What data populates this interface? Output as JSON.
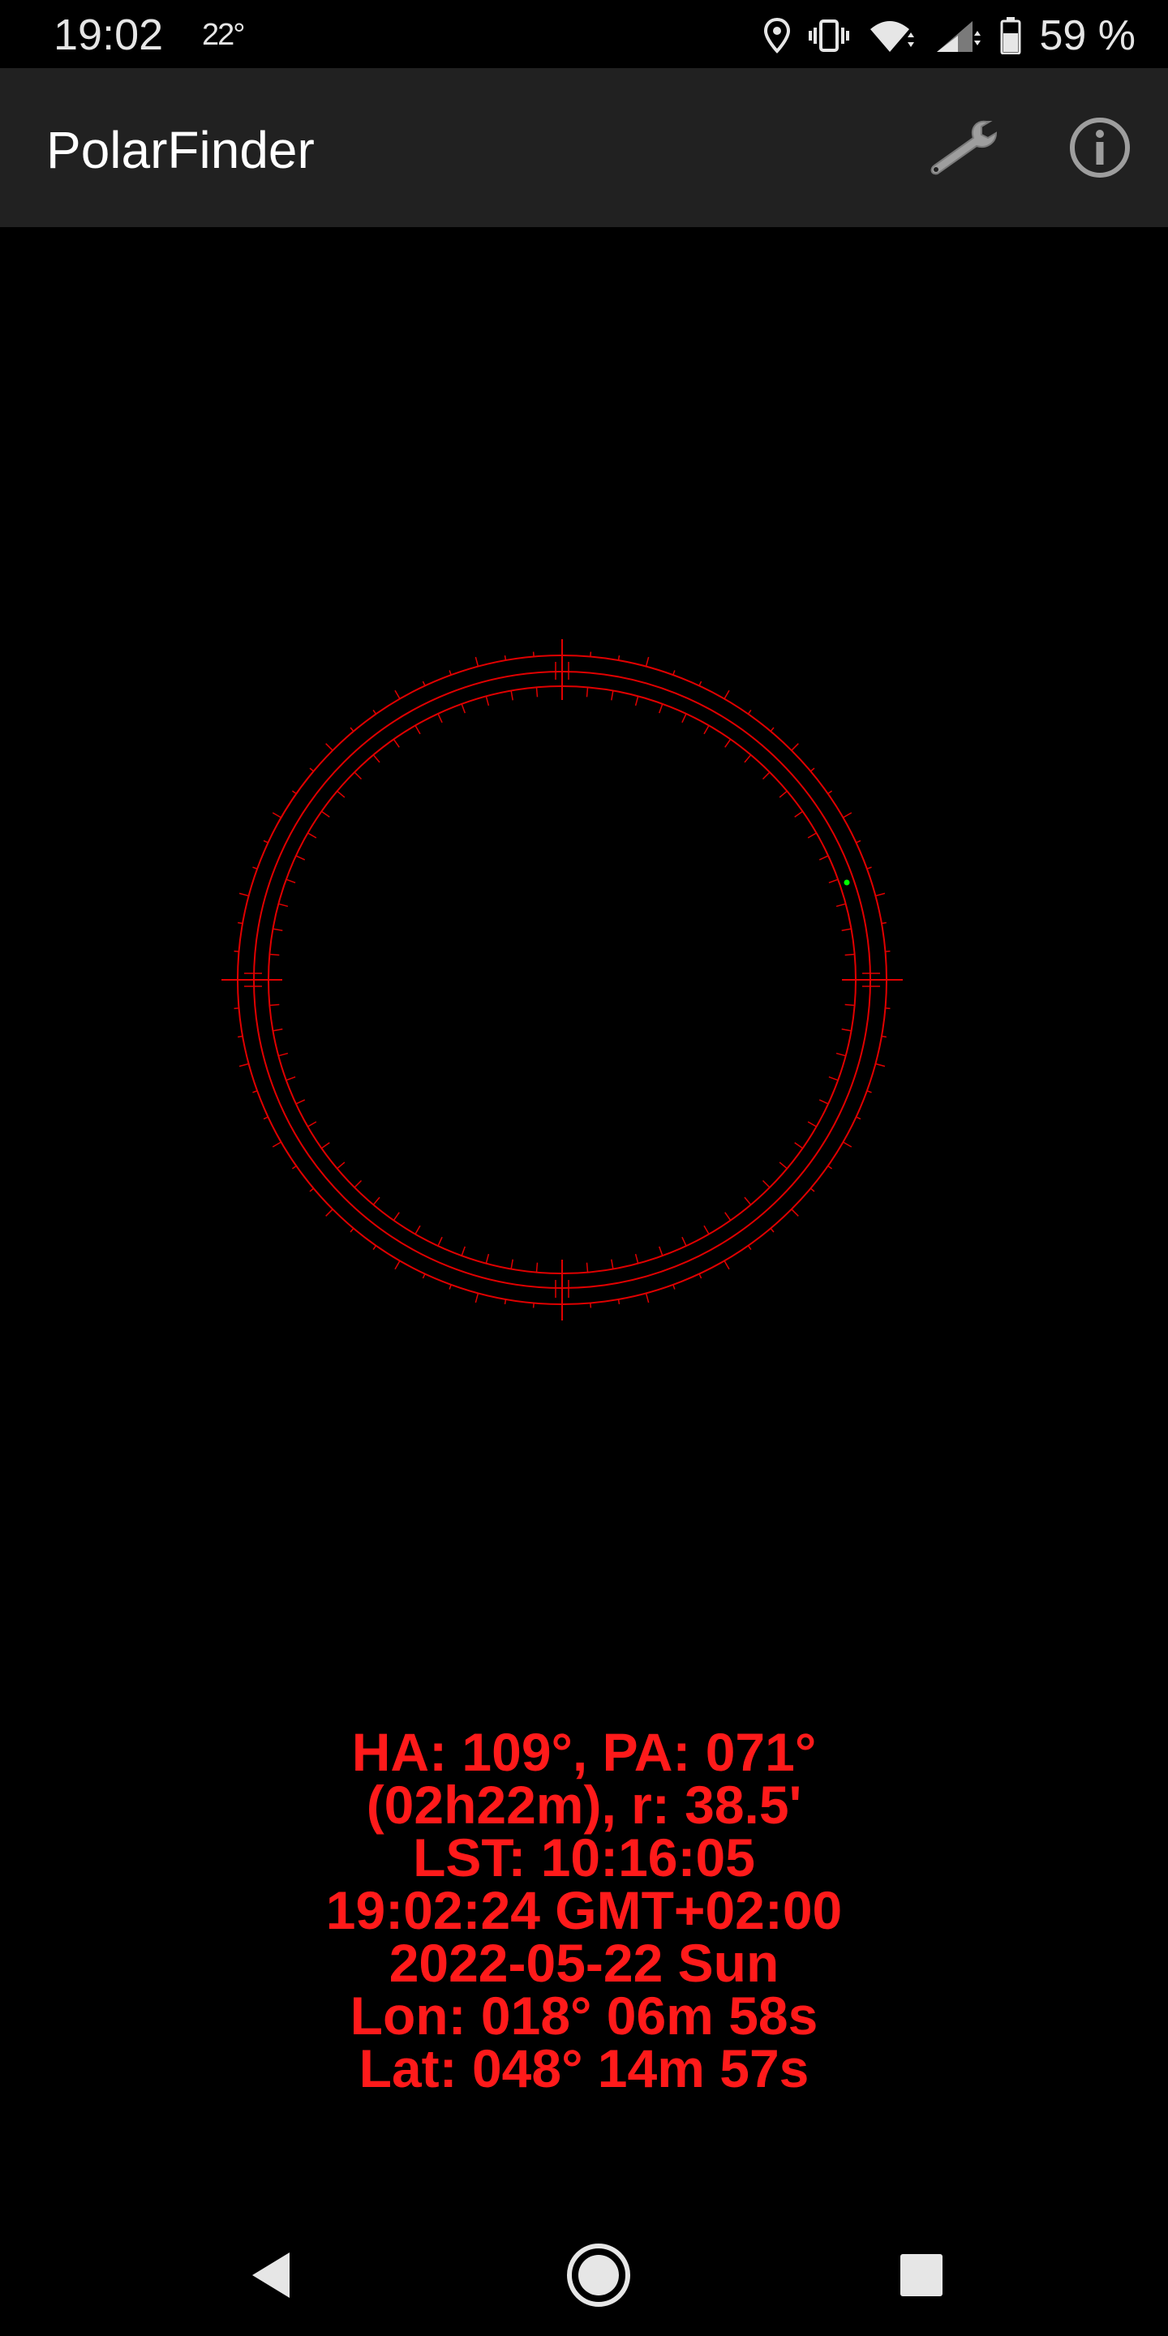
{
  "status_bar": {
    "time": "19:02",
    "temperature": "22°",
    "battery_percent": "59 %",
    "icons": [
      "location-icon",
      "vibrate-icon",
      "wifi-icon",
      "signal-icon",
      "battery-icon"
    ]
  },
  "app_bar": {
    "title": "PolarFinder",
    "actions": [
      "wrench-icon",
      "info-icon"
    ]
  },
  "reticle": {
    "ring_color": "#e00000",
    "polaris_marker_color": "#00ff00"
  },
  "readout": {
    "lines": [
      "HA: 109°, PA: 071°",
      "(02h22m), r: 38.5'",
      "LST: 10:16:05",
      "19:02:24 GMT+02:00",
      "2022-05-22 Sun",
      "Lon: 018° 06m 58s",
      "Lat: 048° 14m 57s"
    ],
    "color": "#ff1a1a"
  },
  "nav_bar": {
    "buttons": [
      "back-icon",
      "home-icon",
      "recents-icon"
    ]
  }
}
